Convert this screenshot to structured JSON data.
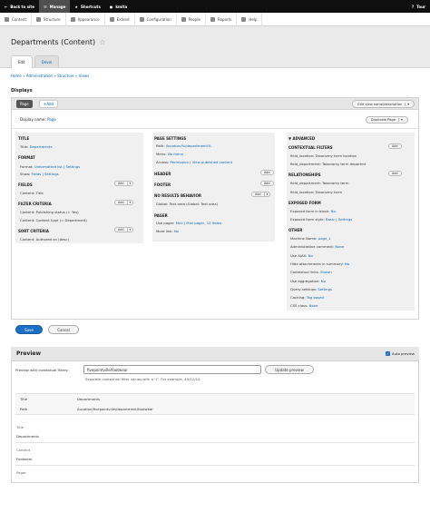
{
  "toolbar": {
    "back": "Back to site",
    "manage": "Manage",
    "shortcuts": "Shortcuts",
    "user": "kmita",
    "tour": "Tour"
  },
  "tray": {
    "items": [
      "Content",
      "Structure",
      "Appearance",
      "Extend",
      "Configuration",
      "People",
      "Reports",
      "Help"
    ]
  },
  "page": {
    "title": "Departments (Content)",
    "tabs": [
      "Edit",
      "Devel"
    ],
    "breadcrumb": [
      "Home",
      "Administration",
      "Structure",
      "Views"
    ],
    "displays_label": "Displays"
  },
  "displays": {
    "tab_page": "Page",
    "tab_add": "+Add",
    "edit_name_btn": "Edit view name/description",
    "display_name_label": "Display name:",
    "display_name_value": "Page",
    "duplicate_btn": "Duplicate Page"
  },
  "col1": {
    "title_head": "TITLE",
    "title_label": "Title:",
    "title_value": "Departments",
    "format_head": "FORMAT",
    "format_label": "Format:",
    "format_value": "Unformatted list",
    "format_sep": "|",
    "format_settings": "Settings",
    "show_label": "Show:",
    "show_value": "Fields",
    "show_sep": "|",
    "show_settings": "Settings",
    "fields_head": "FIELDS",
    "fields_item": "Content: Title",
    "filter_head": "FILTER CRITERIA",
    "filter_items": [
      "Content: Publishing status (= Yes)",
      "Content: Content type (= Department)"
    ],
    "sort_head": "SORT CRITERIA",
    "sort_item": "Content: Authored on (desc)",
    "add": "Add"
  },
  "col2": {
    "page_settings_head": "PAGE SETTINGS",
    "path_label": "Path:",
    "path_value": "/location/%/department/%",
    "menu_label": "Menu:",
    "menu_value": "No menu",
    "access_label": "Access:",
    "access_value": "Permission",
    "access_sep": "|",
    "access_value2": "View published content",
    "header_head": "HEADER",
    "footer_head": "FOOTER",
    "noresults_head": "NO RESULTS BEHAVIOR",
    "noresults_item": "Global: Text area (Global: Text area)",
    "pager_head": "PAGER",
    "use_pager_label": "Use pager:",
    "use_pager_value": "Mini",
    "use_pager_sep": "|",
    "use_pager_value2": "Mini pager, 10 items",
    "more_link_label": "More link:",
    "more_link_value": "No",
    "add": "Add"
  },
  "col3": {
    "advanced_head": "▼ ADVANCED",
    "contextual_head": "CONTEXTUAL FILTERS",
    "contextual_items": [
      "field_location: Taxonomy term location",
      "field_department: Taxonomy term departmt"
    ],
    "relationships_head": "RELATIONSHIPS",
    "relationship_items": [
      "field_department: Taxonomy term",
      "field_location: Taxonomy term"
    ],
    "exposed_head": "EXPOSED FORM",
    "exposed_block_label": "Exposed form in block:",
    "exposed_block_value": "No",
    "exposed_style_label": "Exposed form style:",
    "exposed_style_value": "Basic",
    "exposed_style_sep": "|",
    "exposed_style_settings": "Settings",
    "other_head": "OTHER",
    "other_rows": [
      {
        "label": "Machine Name:",
        "value": "page_1"
      },
      {
        "label": "Administrative comment:",
        "value": "None"
      },
      {
        "label": "Use AJAX:",
        "value": "No"
      },
      {
        "label": "Hide attachments in summary:",
        "value": "No"
      },
      {
        "label": "Contextual links:",
        "value": "Shown"
      },
      {
        "label": "Use aggregation:",
        "value": "No"
      },
      {
        "label": "Query settings:",
        "value": "Settings"
      },
      {
        "label": "Caching:",
        "value": "Tag based"
      },
      {
        "label": "CSS class:",
        "value": "None"
      }
    ],
    "add": "Add"
  },
  "actions": {
    "save": "Save",
    "cancel": "Cancel"
  },
  "preview": {
    "heading": "Preview",
    "auto_preview": "Auto preview",
    "contextual_label": "Preview with contextual filters:",
    "contextual_value": "fivepointville/footwear",
    "update_btn": "Update preview",
    "hint": "Separate contextual filter values with a \"/\". For example, 40/12/10.",
    "table": [
      {
        "key": "Title",
        "value": "Departments"
      },
      {
        "key": "Path",
        "value": "/location/fivepointville/department/footwear"
      }
    ],
    "results": [
      {
        "label": "Title",
        "value": "Departments"
      },
      {
        "label": "Content",
        "value": "Footwear"
      },
      {
        "label": "Pager",
        "value": ""
      }
    ]
  },
  "colors": {
    "link": "#0a65ad",
    "toolbar": "#0f0f0f",
    "primary_button": "#1b6fc5"
  }
}
